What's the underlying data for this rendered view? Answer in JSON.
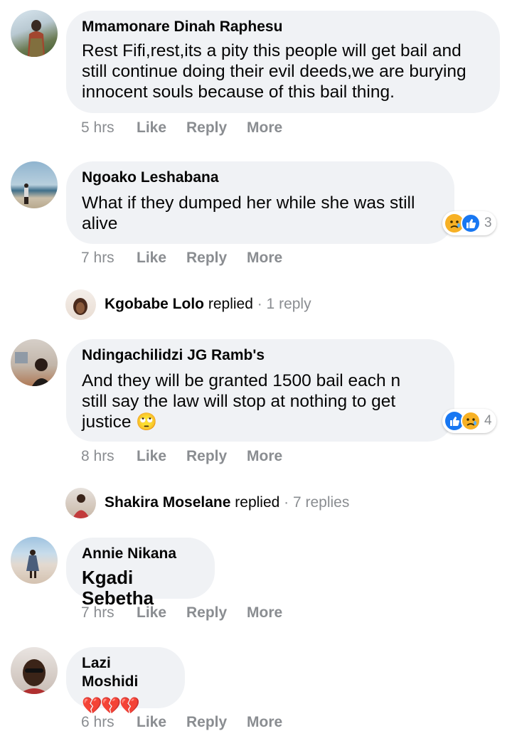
{
  "colors": {
    "bubble": "#f0f2f5",
    "meta": "#8a8d91",
    "like_blue": "#1877f2",
    "sad_yellow": "#f7b125",
    "heart_red": "#e02c3c"
  },
  "comments": [
    {
      "author": "Mmamonare Dinah Raphesu",
      "lines": [
        "Rest Fifi,rest,its a pity this people will get bail and",
        "still continue doing their evil deeds,we are burying",
        "innocent souls because of this bail thing."
      ],
      "time": "5 hrs",
      "like": "Like",
      "reply": "Reply",
      "more": "More"
    },
    {
      "author": "Ngoako Leshabana",
      "lines": [
        "What if they dumped her while she was still",
        "alive"
      ],
      "time": "7 hrs",
      "like": "Like",
      "reply": "Reply",
      "more": "More",
      "reactions": {
        "icons": [
          "sad-react-icon",
          "like-react-icon"
        ],
        "count": "3"
      },
      "replies": {
        "name": "Kgobabe Lolo",
        "verb": "replied",
        "count": "· 1 reply"
      }
    },
    {
      "author": "Ndingachilidzi JG Ramb's",
      "lines": [
        "And they will be granted 1500 bail each n",
        "still say the law will stop at nothing to get",
        "justice"
      ],
      "emoji": "🙄",
      "time": "8 hrs",
      "like": "Like",
      "reply": "Reply",
      "more": "More",
      "reactions": {
        "icons": [
          "like-react-icon",
          "sad-react-icon"
        ],
        "count": "4"
      },
      "replies": {
        "name": "Shakira Moselane",
        "verb": "replied",
        "count": "· 7 replies"
      }
    },
    {
      "author": "Annie Nikana",
      "lines": [
        "Kgadi Sebetha"
      ],
      "time": "7 hrs",
      "like": "Like",
      "reply": "Reply",
      "more": "More"
    },
    {
      "author": "Lazi Moshidi",
      "hearts": "💔💔💔",
      "time": "6 hrs",
      "like": "Like",
      "reply": "Reply",
      "more": "More"
    }
  ]
}
